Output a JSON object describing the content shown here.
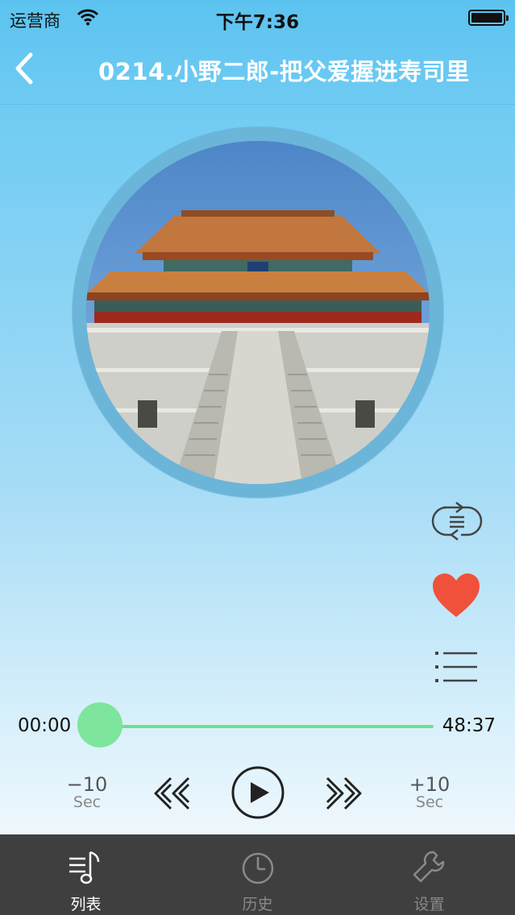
{
  "status_bar": {
    "carrier": "运营商",
    "time": "下午7:36"
  },
  "nav": {
    "title": "0214.小野二郎-把父爱握进寿司里"
  },
  "player": {
    "current_time": "00:00",
    "total_time": "48:37",
    "progress": 0,
    "skip_back": {
      "amount": "−10",
      "unit": "Sec"
    },
    "skip_forward": {
      "amount": "+10",
      "unit": "Sec"
    },
    "favorited": true
  },
  "tabs": [
    {
      "label": "列表",
      "icon": "music-list-icon",
      "active": true
    },
    {
      "label": "历史",
      "icon": "clock-icon",
      "active": false
    },
    {
      "label": "设置",
      "icon": "wrench-icon",
      "active": false
    }
  ],
  "colors": {
    "heart": "#f0513a",
    "progress": "#6ee08e",
    "tabbar": "#3f3f3f"
  }
}
